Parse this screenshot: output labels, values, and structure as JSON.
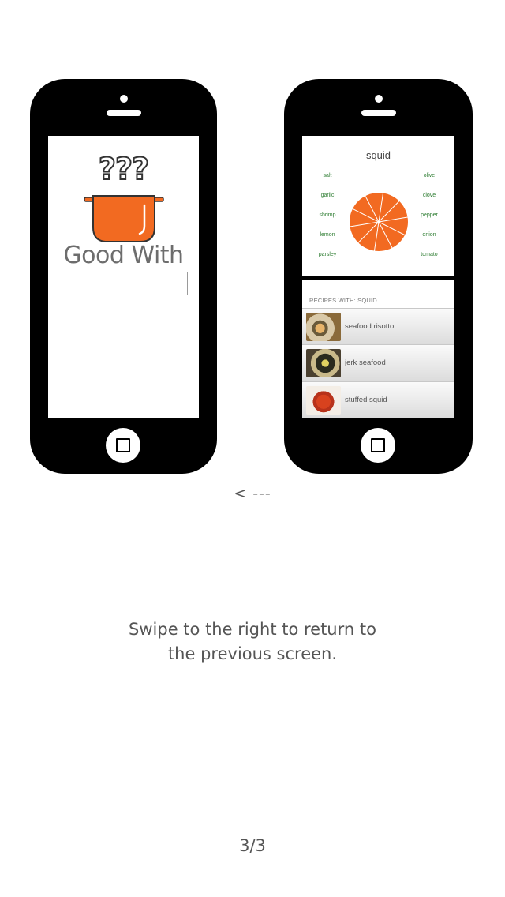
{
  "phone_left": {
    "question_marks": "???",
    "app_title": "Good With",
    "search_value": "",
    "pot_color": "#f26a21"
  },
  "phone_right": {
    "ingredient_title": "squid",
    "ingredients_left": [
      "salt",
      "garlic",
      "shrimp",
      "lemon",
      "parsley"
    ],
    "ingredients_right": [
      "olive",
      "clove",
      "pepper",
      "onion",
      "tomato"
    ],
    "pie_color": "#f26a21",
    "ingredient_text_color": "#2e7d32",
    "recipes_header": "RECIPES WITH: SQUID",
    "recipes": [
      "seafood risotto",
      "jerk seafood",
      "stuffed squid"
    ]
  },
  "arrow_hint": "< ---",
  "instruction": {
    "line1": "Swipe to the right to return to",
    "line2": "the previous screen."
  },
  "pager": "3/3"
}
